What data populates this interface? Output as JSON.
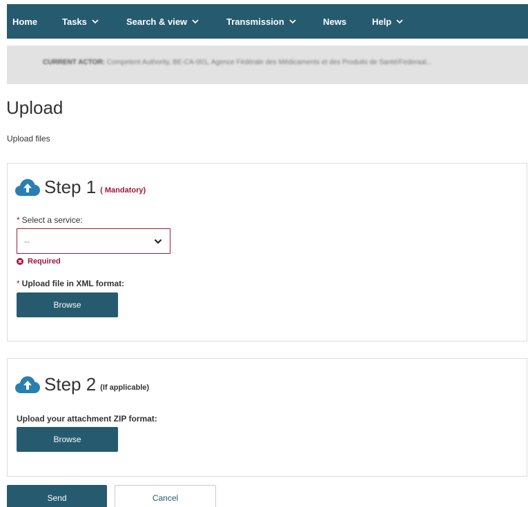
{
  "nav": {
    "items": [
      {
        "label": "Home",
        "has_dropdown": false
      },
      {
        "label": "Tasks",
        "has_dropdown": true
      },
      {
        "label": "Search & view",
        "has_dropdown": true
      },
      {
        "label": "Transmission",
        "has_dropdown": true
      },
      {
        "label": "News",
        "has_dropdown": false
      },
      {
        "label": "Help",
        "has_dropdown": true
      }
    ]
  },
  "actor_bar": {
    "label": "CURRENT ACTOR:",
    "value": "Competent Authority, BE-CA-001, Agence Fédérale des Médicaments et des Produits de Santé/Federaal..."
  },
  "page": {
    "title": "Upload",
    "subtitle": "Upload files"
  },
  "step1": {
    "title": "Step 1",
    "note": "( Mandatory)",
    "service_label": "Select a service:",
    "service_value": "--",
    "required_msg": "Required",
    "file_label": "Upload file in XML format:",
    "browse_label": "Browse"
  },
  "step2": {
    "title": "Step 2",
    "note": "(If applicable)",
    "file_label": "Upload your attachment ZIP format:",
    "browse_label": "Browse"
  },
  "actions": {
    "send_label": "Send",
    "cancel_label": "Cancel"
  },
  "colors": {
    "primary": "#265a6e",
    "error": "#a0183a",
    "cloud_icon": "#2a7fb0"
  }
}
